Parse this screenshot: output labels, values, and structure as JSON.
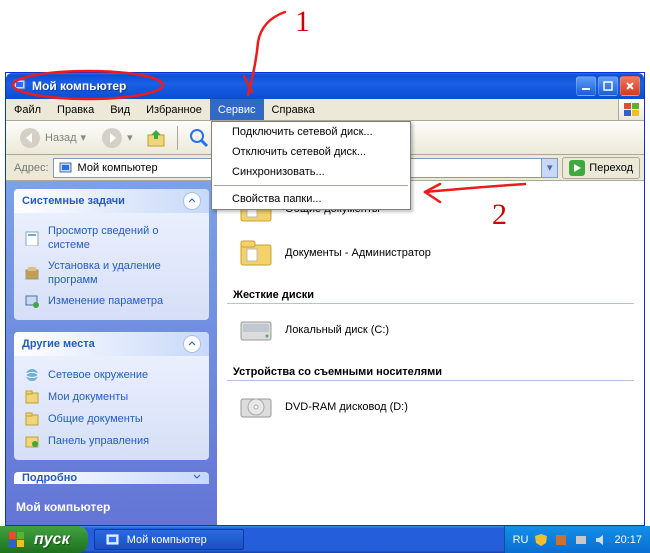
{
  "window": {
    "title": "Мой компьютер",
    "menus": [
      "Файл",
      "Правка",
      "Вид",
      "Избранное",
      "Сервис",
      "Справка"
    ],
    "active_menu_index": 4,
    "back_label": "Назад",
    "address_label": "Адрес:",
    "address_value": "Мой компьютер",
    "go_label": "Переход"
  },
  "dropdown": {
    "items_top": [
      "Подключить сетевой диск...",
      "Отключить сетевой диск...",
      "Синхронизовать..."
    ],
    "item_bottom": "Свойства папки..."
  },
  "sidebar": {
    "tasks_header": "Системные задачи",
    "tasks": [
      "Просмотр сведений о системе",
      "Установка и удаление программ",
      "Изменение параметра"
    ],
    "places_header": "Другие места",
    "places": [
      "Сетевое окружение",
      "Мои документы",
      "Общие документы",
      "Панель управления"
    ],
    "details_header": "Подробно",
    "footer_title": "Мой компьютер"
  },
  "main": {
    "folders": [
      "Общие документы",
      "Документы - Администратор"
    ],
    "group_hdd": "Жесткие диски",
    "hdd_item": "Локальный диск (C:)",
    "group_removable": "Устройства со съемными носителями",
    "removable_item": "DVD-RAM дисковод (D:)"
  },
  "taskbar": {
    "start": "пуск",
    "task_item": "Мой компьютер",
    "lang": "RU",
    "clock": "20:17"
  },
  "annotations": {
    "one": "1",
    "two": "2"
  }
}
